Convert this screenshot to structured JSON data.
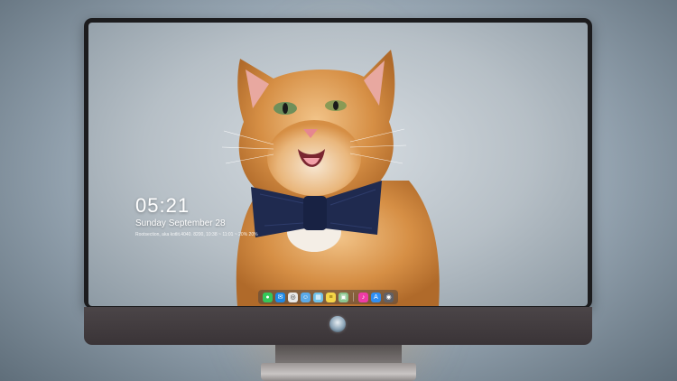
{
  "lock_screen": {
    "time": "05:21",
    "date": "Sunday September 28",
    "subline": "Rootsection, aka kotlit.4040. 8200, 10:38 ~ 11:01 ~ 20% 20%"
  },
  "dock": {
    "items": [
      {
        "name": "messages-icon",
        "color": "#34c759",
        "glyph": "●"
      },
      {
        "name": "mail-icon",
        "color": "#1e88e5",
        "glyph": "✉"
      },
      {
        "name": "safari-icon",
        "color": "#e8e8e8",
        "glyph": "◎"
      },
      {
        "name": "finder-icon",
        "color": "#5aa9e6",
        "glyph": "☺"
      },
      {
        "name": "photos-icon",
        "color": "#6fc1e8",
        "glyph": "▦"
      },
      {
        "name": "notes-icon",
        "color": "#f5d547",
        "glyph": "≡"
      },
      {
        "name": "preview-icon",
        "color": "#8bc58f",
        "glyph": "▣"
      },
      {
        "name": "music-icon",
        "color": "#ee3ba6",
        "glyph": "♪"
      },
      {
        "name": "app-store-icon",
        "color": "#2f8ef2",
        "glyph": "A"
      },
      {
        "name": "camera-icon",
        "color": "#606066",
        "glyph": "◉"
      }
    ]
  },
  "colors": {
    "bezel": "#1c1c1e",
    "chin": "#3f393c",
    "bowtie": "#1f2a4f",
    "fur": "#d68f45"
  }
}
